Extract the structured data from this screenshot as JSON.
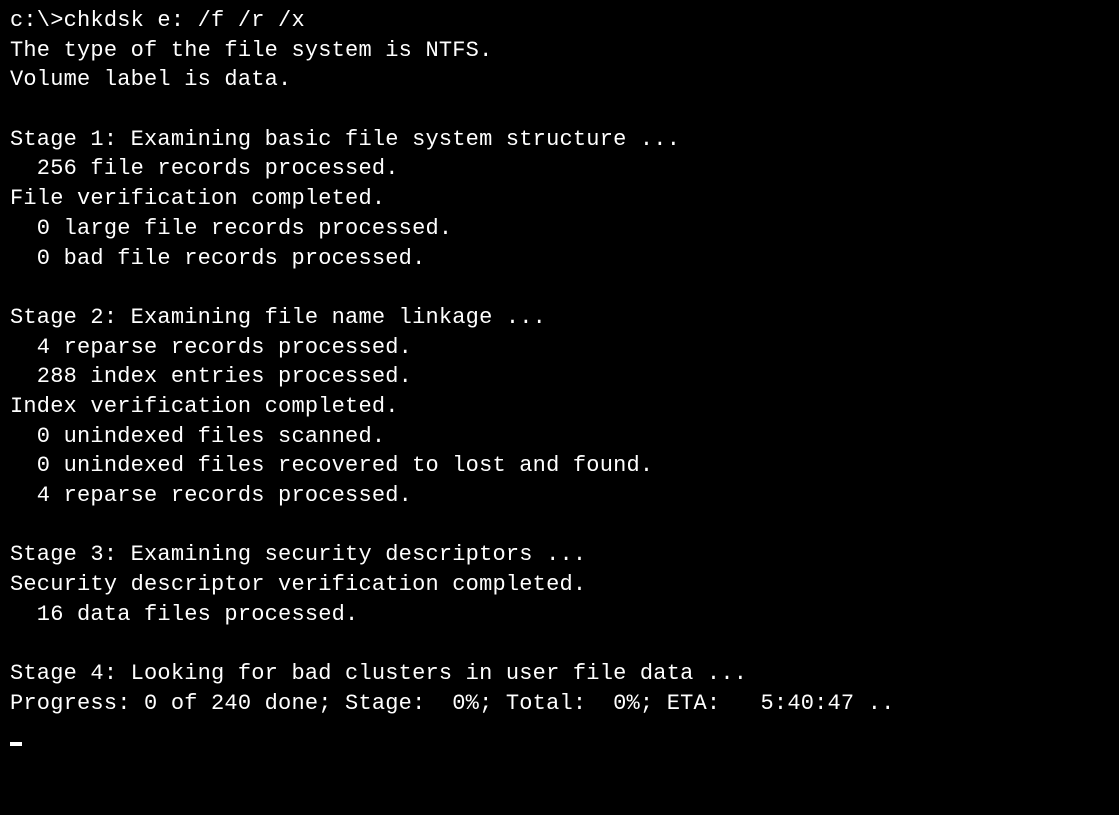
{
  "prompt": "c:\\>",
  "command": "chkdsk e: /f /r /x",
  "header": {
    "fs_type": "The type of the file system is NTFS.",
    "volume": "Volume label is data."
  },
  "stage1": {
    "title": "Stage 1: Examining basic file system structure ...",
    "l1": "  256 file records processed.",
    "l2": "File verification completed.",
    "l3": "  0 large file records processed.",
    "l4": "  0 bad file records processed."
  },
  "stage2": {
    "title": "Stage 2: Examining file name linkage ...",
    "l1": "  4 reparse records processed.",
    "l2": "  288 index entries processed.",
    "l3": "Index verification completed.",
    "l4": "  0 unindexed files scanned.",
    "l5": "  0 unindexed files recovered to lost and found.",
    "l6": "  4 reparse records processed."
  },
  "stage3": {
    "title": "Stage 3: Examining security descriptors ...",
    "l1": "Security descriptor verification completed.",
    "l2": "  16 data files processed."
  },
  "stage4": {
    "title": "Stage 4: Looking for bad clusters in user file data ...",
    "progress": "Progress: 0 of 240 done; Stage:  0%; Total:  0%; ETA:   5:40:47 .."
  }
}
